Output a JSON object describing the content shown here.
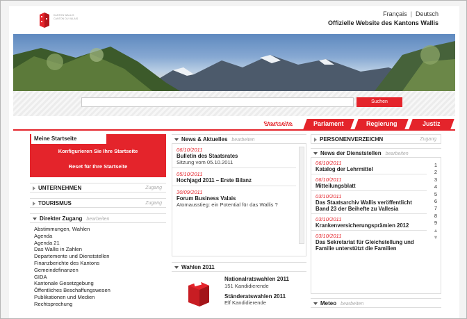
{
  "header": {
    "logo_text": "KANTON WALLIS CANTON DU VALAIS",
    "lang_fr": "Français",
    "lang_sep": "|",
    "lang_de": "Deutsch",
    "title": "Offizielle Website des Kantons Wallis"
  },
  "search": {
    "placeholder": "",
    "button_label": "Suchen"
  },
  "tabs": [
    {
      "label": "Startseite",
      "active": true
    },
    {
      "label": "Parlament",
      "active": false
    },
    {
      "label": "Regierung",
      "active": false
    },
    {
      "label": "Justiz",
      "active": false
    }
  ],
  "left": {
    "meine_title": "Meine Startseite",
    "configure": "Konfigurieren Sie Ihre Startseite",
    "reset": "Reset für Ihre Startseite",
    "unternehmen": "UNTERNEHMEN",
    "tourismus": "TOURISMUS",
    "zugang": "Zugang",
    "direkter_title": "Direkter Zugang",
    "edit": "bearbeiten",
    "links": [
      "Abstimmungen, Wahlen",
      "Agenda",
      "Agenda 21",
      "Das Wallis in Zahlen",
      "Departemente und Dienststellen",
      "Finanzberichte des Kantons",
      "Gemeindefinanzen",
      "GIDA",
      "Kantonale Gesetzgebung",
      "Öffentliches Beschaffungswesen",
      "Publikationen und Medien",
      "Rechtsprechung"
    ]
  },
  "middle": {
    "news_title": "News & Aktuelles",
    "edit": "bearbeiten",
    "news": [
      {
        "date": "06/10/2011",
        "title": "Bulletin des Staatsrates",
        "text": "Sitzung vom 05.10.2011"
      },
      {
        "date": "05/10/2011",
        "title": "Hochjagd 2011 – Erste Bilanz",
        "text": ""
      },
      {
        "date": "30/09/2011",
        "title": "Forum Business Valais",
        "text": "Atomausstieg: ein Potential für das Wallis ?"
      }
    ],
    "wahlen_title": "Wahlen 2011",
    "wahlen": [
      {
        "title": "Nationalratswahlen 2011",
        "count": "151 Kandidierende"
      },
      {
        "title": "Ständeratswahlen 2011",
        "count": "Elf Kandidierende"
      }
    ]
  },
  "right": {
    "personen": "PERSONENVERZEICHN",
    "zugang": "Zugang",
    "dienst_title": "News der Dienststellen",
    "edit": "bearbeiten",
    "items": [
      {
        "date": "06/10/2011",
        "title": "Katalog der Lehrmittel"
      },
      {
        "date": "06/10/2011",
        "title": "Mitteilungsblatt"
      },
      {
        "date": "03/10/2011",
        "title": "Das Staatsarchiv Wallis veröffentlicht Band 23 der Beihefte zu Vallesia"
      },
      {
        "date": "03/10/2011",
        "title": "Krankenversicherungsprämien 2012"
      },
      {
        "date": "03/10/2011",
        "title": "Das Sekretariat für Gleichstellung und Familie unterstützt die Familien"
      }
    ],
    "pages": [
      "1",
      "2",
      "3",
      "4",
      "5",
      "6",
      "7",
      "8",
      "9"
    ],
    "meteo_title": "Meteo",
    "meteo_edit": "bearbeiten"
  },
  "colors": {
    "accent": "#e4242b"
  }
}
